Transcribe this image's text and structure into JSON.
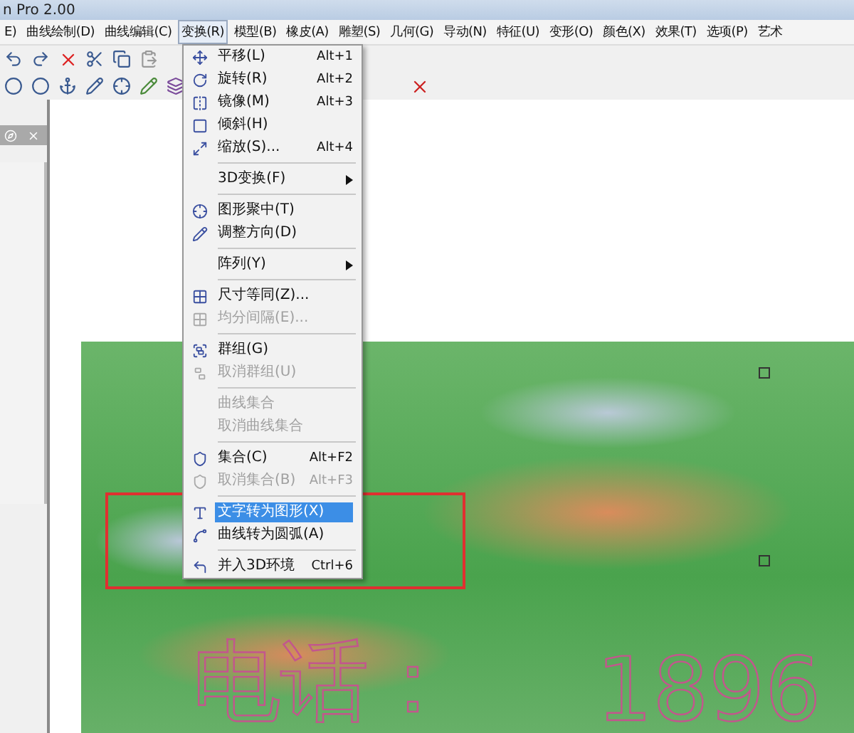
{
  "window": {
    "title": "n Pro 2.00"
  },
  "menu_bar": [
    {
      "label": "E)",
      "selected": false
    },
    {
      "label": "曲线绘制(D)",
      "selected": false
    },
    {
      "label": "曲线编辑(C)",
      "selected": false
    },
    {
      "label": "变换(R)",
      "selected": true
    },
    {
      "label": "模型(B)",
      "selected": false
    },
    {
      "label": "橡皮(A)",
      "selected": false
    },
    {
      "label": "雕塑(S)",
      "selected": false
    },
    {
      "label": "几何(G)",
      "selected": false
    },
    {
      "label": "导动(N)",
      "selected": false
    },
    {
      "label": "特征(U)",
      "selected": false
    },
    {
      "label": "变形(O)",
      "selected": false
    },
    {
      "label": "颜色(X)",
      "selected": false
    },
    {
      "label": "效果(T)",
      "selected": false
    },
    {
      "label": "选项(P)",
      "selected": false
    },
    {
      "label": "艺术",
      "selected": false
    }
  ],
  "menu": [
    {
      "kind": "item",
      "label": "平移(L)",
      "shortcut": "Alt+1",
      "disabled": false,
      "selected": false
    },
    {
      "kind": "item",
      "label": "旋转(R)",
      "shortcut": "Alt+2",
      "disabled": false,
      "selected": false
    },
    {
      "kind": "item",
      "label": "镜像(M)",
      "shortcut": "Alt+3",
      "disabled": false,
      "selected": false
    },
    {
      "kind": "item",
      "label": "倾斜(H)",
      "disabled": false,
      "selected": false
    },
    {
      "kind": "item",
      "label": "缩放(S)...",
      "shortcut": "Alt+4",
      "disabled": false,
      "selected": false
    },
    {
      "kind": "separator"
    },
    {
      "kind": "submenu",
      "label": "3D变换(F)",
      "disabled": false,
      "selected": false
    },
    {
      "kind": "separator"
    },
    {
      "kind": "item",
      "label": "图形聚中(T)",
      "disabled": false,
      "selected": false
    },
    {
      "kind": "item",
      "label": "调整方向(D)",
      "disabled": false,
      "selected": false
    },
    {
      "kind": "separator"
    },
    {
      "kind": "submenu",
      "label": "阵列(Y)",
      "disabled": false,
      "selected": false
    },
    {
      "kind": "separator"
    },
    {
      "kind": "item",
      "label": "尺寸等同(Z)...",
      "disabled": false,
      "selected": false
    },
    {
      "kind": "item",
      "label": "均分间隔(E)...",
      "disabled": true,
      "selected": false
    },
    {
      "kind": "separator"
    },
    {
      "kind": "item",
      "label": "群组(G)",
      "disabled": false,
      "selected": false
    },
    {
      "kind": "item",
      "label": "取消群组(U)",
      "disabled": true,
      "selected": false
    },
    {
      "kind": "separator"
    },
    {
      "kind": "item",
      "label": "曲线集合",
      "disabled": true,
      "selected": false
    },
    {
      "kind": "item",
      "label": "取消曲线集合",
      "disabled": true,
      "selected": false
    },
    {
      "kind": "separator"
    },
    {
      "kind": "item",
      "label": "集合(C)",
      "shortcut": "Alt+F2",
      "disabled": false,
      "selected": false
    },
    {
      "kind": "item",
      "label": "取消集合(B)",
      "shortcut": "Alt+F3",
      "disabled": true,
      "selected": false
    },
    {
      "kind": "separator"
    },
    {
      "kind": "item",
      "label": "文字转为图形(X)",
      "disabled": false,
      "selected": true
    },
    {
      "kind": "item",
      "label": "曲线转为圆弧(A)",
      "disabled": false,
      "selected": false
    },
    {
      "kind": "separator"
    },
    {
      "kind": "item",
      "label": "并入3D环境",
      "shortcut": "Ctrl+6",
      "disabled": false,
      "selected": false
    }
  ],
  "canvas": {
    "artwork_text": [
      {
        "text": "电话："
      },
      {
        "text": "1896"
      }
    ]
  }
}
